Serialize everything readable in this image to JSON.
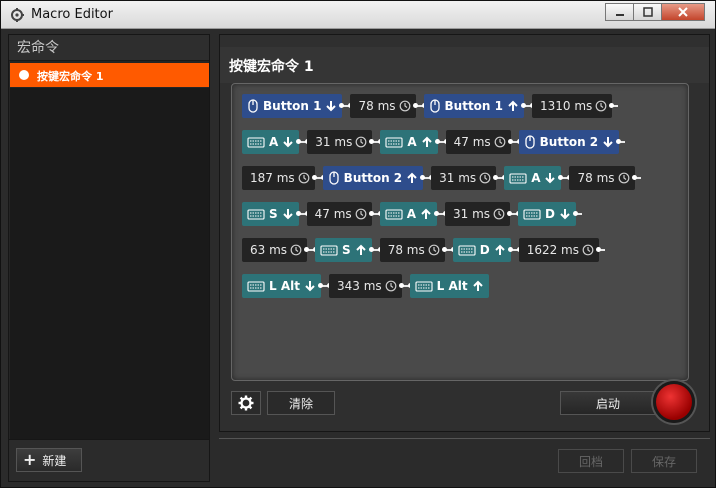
{
  "window": {
    "title": "Macro Editor"
  },
  "sidebar": {
    "header": "宏命令",
    "items": [
      {
        "label": "按键宏命令 1",
        "selected": true
      }
    ],
    "new_button": "新建"
  },
  "main": {
    "macro_title": "按键宏命令 1",
    "rows": [
      [
        {
          "kind": "mouse",
          "label": "Button 1",
          "dir": "down"
        },
        {
          "kind": "delay",
          "label": "78 ms"
        },
        {
          "kind": "mouse",
          "label": "Button 1",
          "dir": "up"
        },
        {
          "kind": "delay",
          "label": "1310 ms"
        }
      ],
      [
        {
          "kind": "key",
          "label": "A",
          "dir": "down"
        },
        {
          "kind": "delay",
          "label": "31 ms"
        },
        {
          "kind": "key",
          "label": "A",
          "dir": "up"
        },
        {
          "kind": "delay",
          "label": "47 ms"
        },
        {
          "kind": "mouse",
          "label": "Button 2",
          "dir": "down"
        }
      ],
      [
        {
          "kind": "delay",
          "label": "187 ms"
        },
        {
          "kind": "mouse",
          "label": "Button 2",
          "dir": "up"
        },
        {
          "kind": "delay",
          "label": "31 ms"
        },
        {
          "kind": "key",
          "label": "A",
          "dir": "down"
        },
        {
          "kind": "delay",
          "label": "78 ms"
        }
      ],
      [
        {
          "kind": "key",
          "label": "S",
          "dir": "down"
        },
        {
          "kind": "delay",
          "label": "47 ms"
        },
        {
          "kind": "key",
          "label": "A",
          "dir": "up"
        },
        {
          "kind": "delay",
          "label": "31 ms"
        },
        {
          "kind": "key",
          "label": "D",
          "dir": "down"
        }
      ],
      [
        {
          "kind": "delay",
          "label": "63 ms"
        },
        {
          "kind": "key",
          "label": "S",
          "dir": "up"
        },
        {
          "kind": "delay",
          "label": "78 ms"
        },
        {
          "kind": "key",
          "label": "D",
          "dir": "up"
        },
        {
          "kind": "delay",
          "label": "1622 ms"
        }
      ],
      [
        {
          "kind": "key",
          "label": "L Alt",
          "dir": "down"
        },
        {
          "kind": "delay",
          "label": "343 ms"
        },
        {
          "kind": "key",
          "label": "L Alt",
          "dir": "up"
        }
      ]
    ],
    "clear_button": "清除",
    "start_button": "启动"
  },
  "footer": {
    "save_button": "保存",
    "back_button": "回档"
  },
  "colors": {
    "accent": "#ff5a00",
    "mouse_chip": "#2e4d8c",
    "key_chip": "#2d7378",
    "delay_chip": "#232323"
  }
}
